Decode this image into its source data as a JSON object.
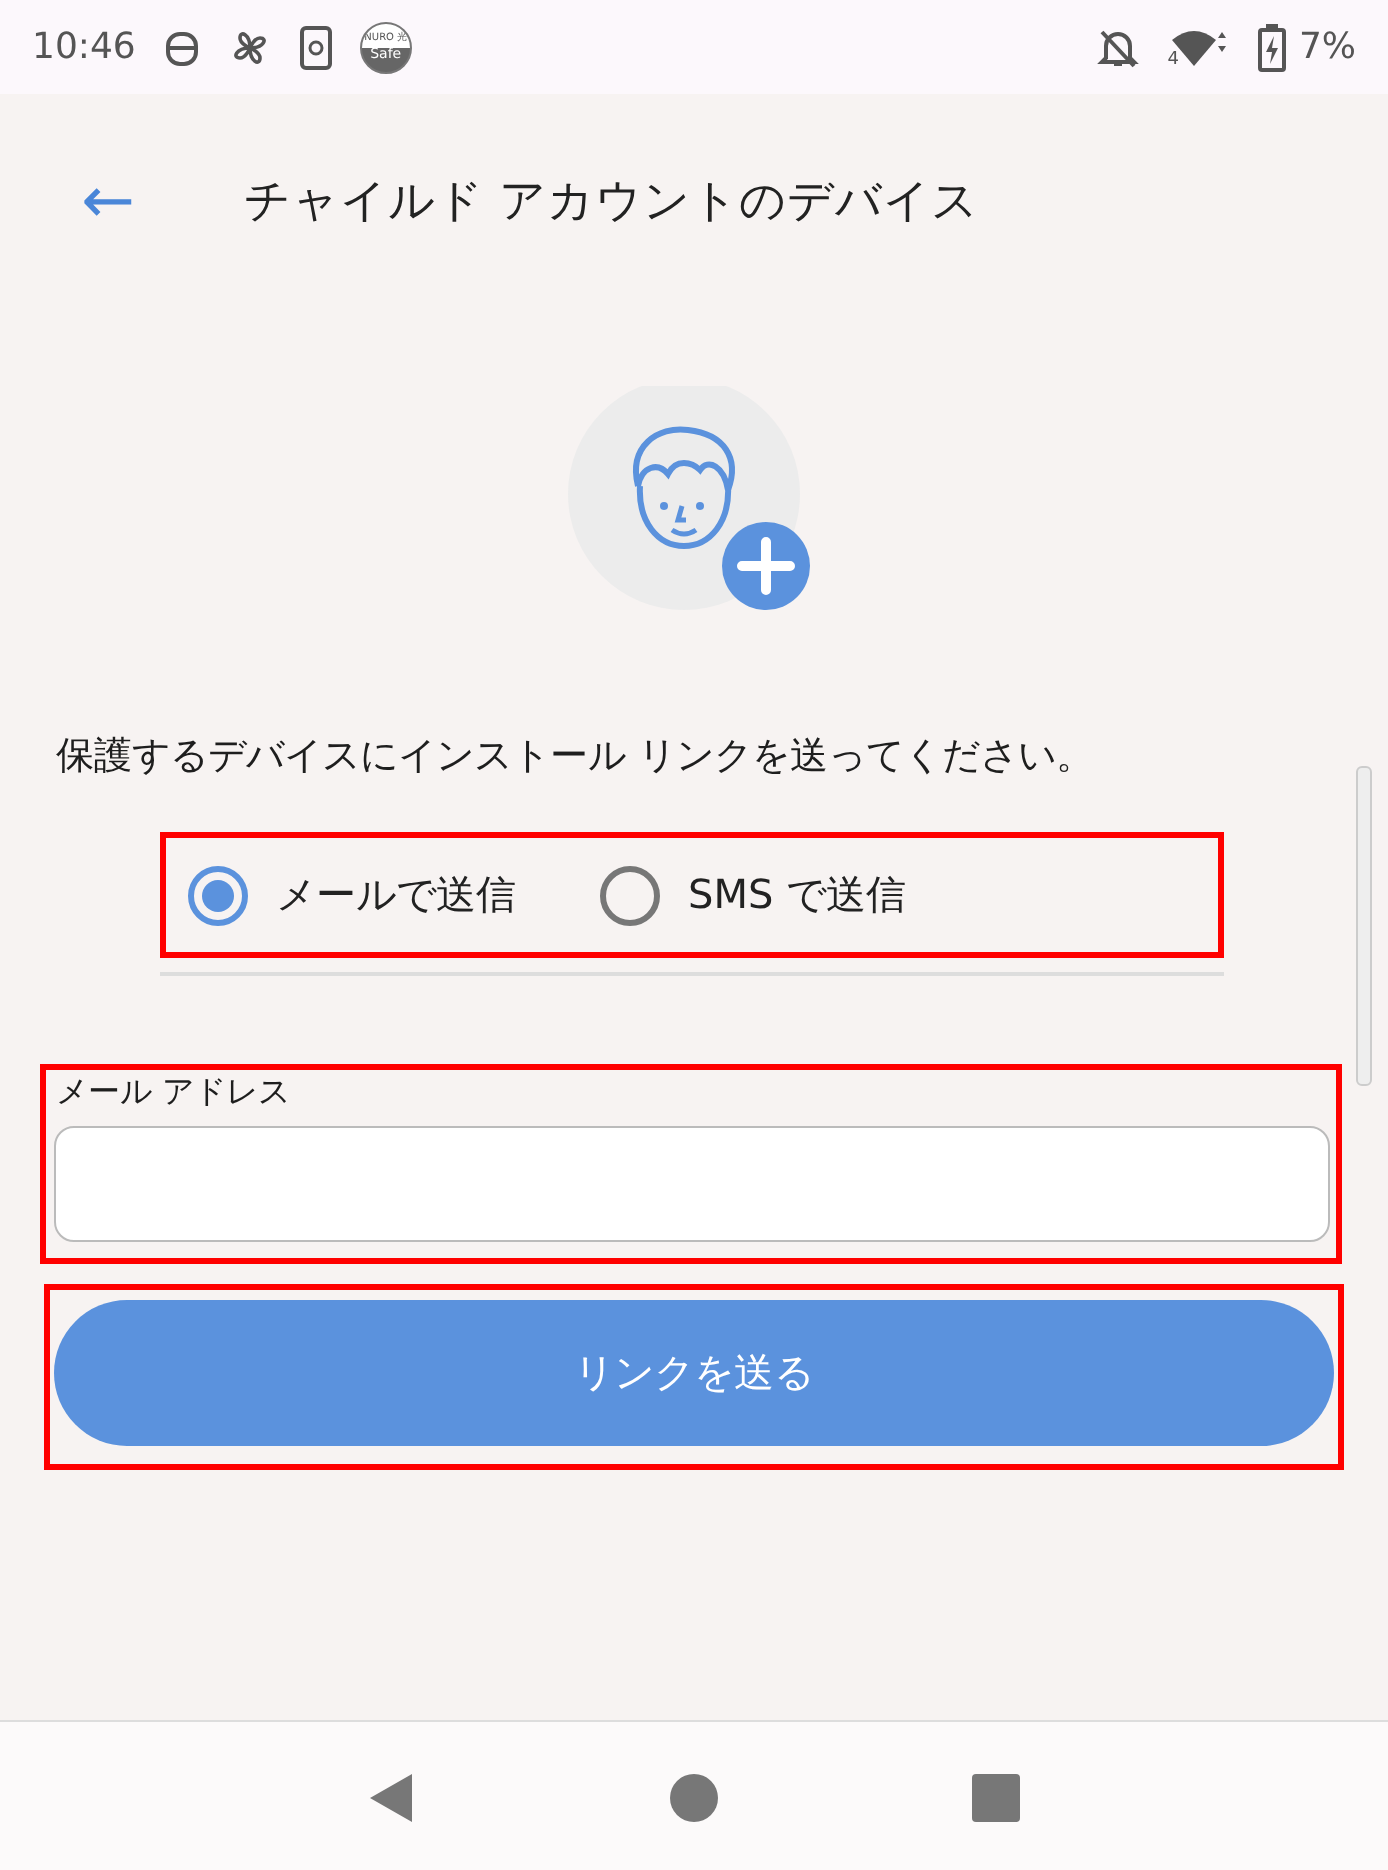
{
  "status_bar": {
    "time": "10:46",
    "app_badge": [
      "NURO 光",
      "Safe"
    ],
    "network_type": "4",
    "battery": "7%"
  },
  "app_bar": {
    "back": "←",
    "title": "チャイルド アカウントのデバイス"
  },
  "instruction": "保護するデバイスにインストール リンクを送ってください。",
  "send_method": {
    "highlighted": true,
    "options": [
      {
        "label": "メールで送信",
        "selected": true
      },
      {
        "label": "SMS で送信",
        "selected": false
      }
    ]
  },
  "email_field": {
    "label": "メール アドレス",
    "highlighted": true
  },
  "send_button": {
    "label": "リンクを送る",
    "highlighted": true
  }
}
